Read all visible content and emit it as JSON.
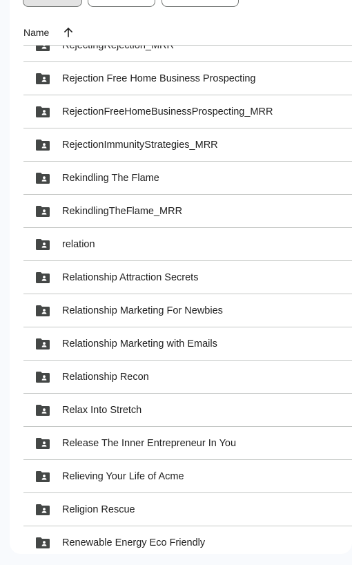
{
  "header": {
    "name_label": "Name",
    "sort_icon": "arrow-up-icon"
  },
  "folder_icon": "shared-folder-icon",
  "rows": [
    {
      "label": "RejectingRejection_MRR"
    },
    {
      "label": "Rejection Free Home Business Prospecting"
    },
    {
      "label": "RejectionFreeHomeBusinessProspecting_MRR"
    },
    {
      "label": "RejectionImmunityStrategies_MRR"
    },
    {
      "label": "Rekindling The Flame"
    },
    {
      "label": "RekindlingTheFlame_MRR"
    },
    {
      "label": "relation"
    },
    {
      "label": "Relationship Attraction Secrets"
    },
    {
      "label": "Relationship Marketing For Newbies"
    },
    {
      "label": "Relationship Marketing with Emails"
    },
    {
      "label": "Relationship Recon"
    },
    {
      "label": "Relax Into Stretch"
    },
    {
      "label": "Release The Inner Entrepreneur In You"
    },
    {
      "label": "Relieving Your Life of Acme"
    },
    {
      "label": "Religion Rescue"
    },
    {
      "label": "Renewable Energy Eco Friendly"
    }
  ]
}
